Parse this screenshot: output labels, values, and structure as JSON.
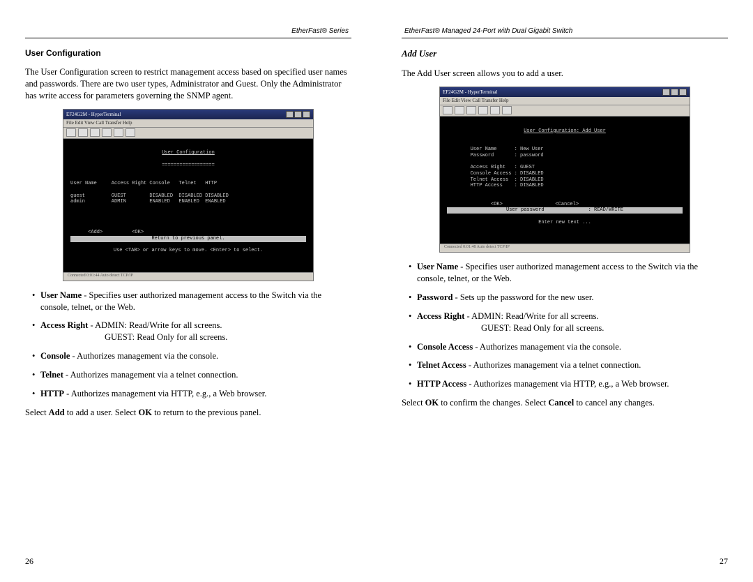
{
  "left": {
    "header": "EtherFast® Series",
    "title": "User Configuration",
    "intro": "The User Configuration screen to restrict management access based on specified user names and passwords. There are two user types, Administrator and Guest. Only the Administrator has write access for parameters governing the SNMP agent.",
    "bullets": [
      {
        "term": "User Name",
        "text": " - Specifies user authorized management access to the Switch via the console, telnet, or the Web."
      },
      {
        "term": "Access Right",
        "text": " - ADMIN: Read/Write for all screens.",
        "cont": "GUEST: Read Only for all screens."
      },
      {
        "term": "Console",
        "text": " - Authorizes management via the console."
      },
      {
        "term": "Telnet",
        "text": " - Authorizes management via a telnet connection."
      },
      {
        "term": "HTTP",
        "text": " - Authorizes management via HTTP, e.g., a Web browser."
      }
    ],
    "tail_pre": "Select ",
    "tail_b1": "Add",
    "tail_mid": " to add a user. Select ",
    "tail_b2": "OK",
    "tail_post": " to return to the previous panel.",
    "page_num": "26",
    "term": {
      "winTitle": "EF24G2M - HyperTerminal",
      "menu": "File  Edit  View  Call  Transfer  Help",
      "title": "User Configuration",
      "dash": "==================",
      "cols": "User Name     Access Right Console   Telnet   HTTP",
      "row1": "guest         GUEST        DISABLED  DISABLED DISABLED",
      "row2": "admin         ADMIN        ENABLED   ENABLED  ENABLED",
      "actions": "      <Add>          <OK>",
      "foot1": "Return to previous panel.",
      "foot2": "Use <TAB> or arrow keys to move. <Enter> to select.",
      "status": "Connected 0:01:44    Auto detect   TCP/IP"
    }
  },
  "right": {
    "header": "EtherFast® Managed 24-Port with Dual Gigabit Switch",
    "title": "Add User",
    "intro": "The Add User screen allows you to add a user.",
    "bullets": [
      {
        "term": "User Name",
        "text": " - Specifies user authorized management access to the Switch via the console, telnet, or the Web."
      },
      {
        "term": "Password",
        "text": " - Sets up the password for the new user."
      },
      {
        "term": "Access Right",
        "text": " - ADMIN: Read/Write for all screens.",
        "cont": "GUEST: Read Only for all screens."
      },
      {
        "term": "Console Access",
        "text": " - Authorizes management via the console."
      },
      {
        "term": "Telnet Access",
        "text": " - Authorizes management via a telnet connection."
      },
      {
        "term": "HTTP Access",
        "text": " - Authorizes management via HTTP, e.g., a Web browser."
      }
    ],
    "tail_pre": "Select ",
    "tail_b1": "OK",
    "tail_mid": " to confirm the changes. Select ",
    "tail_b2": "Cancel",
    "tail_post": " to cancel any changes.",
    "page_num": "27",
    "term": {
      "winTitle": "EF24G2M - HyperTerminal",
      "menu": "File  Edit  View  Call  Transfer  Help",
      "title": "User Configuration: Add User",
      "row1": "User Name      : New User",
      "row2": "Password       : password",
      "row3": "Access Right   : GUEST",
      "row4": "Console Access : DISABLED",
      "row5": "Telnet Access  : DISABLED",
      "row6": "HTTP Access    : DISABLED",
      "actions": "               <OK>                  <Cancel>",
      "foot1": "User password               : READ/WRITE",
      "foot2": "Enter new text ...",
      "status": "Connected 0:01:48    Auto detect   TCP/IP"
    }
  }
}
